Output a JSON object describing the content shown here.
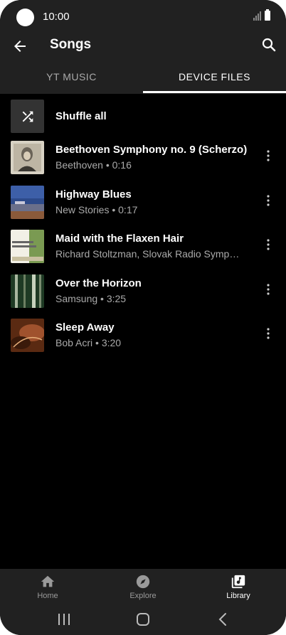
{
  "status_bar": {
    "time": "10:00"
  },
  "app_bar": {
    "title": "Songs"
  },
  "tabs": [
    {
      "label": "YT MUSIC",
      "selected": false
    },
    {
      "label": "DEVICE FILES",
      "selected": true
    }
  ],
  "shuffle": {
    "label": "Shuffle all",
    "icon": "shuffle-icon"
  },
  "songs": [
    {
      "title": "Beethoven Symphony no. 9 (Scherzo)",
      "subtitle": "Beethoven • 0:16"
    },
    {
      "title": "Highway Blues",
      "subtitle": "New Stories • 0:17"
    },
    {
      "title": "Maid with the Flaxen Hair",
      "subtitle": "Richard Stoltzman, Slovak Radio Symp…"
    },
    {
      "title": "Over the Horizon",
      "subtitle": "Samsung • 3:25"
    },
    {
      "title": "Sleep Away",
      "subtitle": "Bob Acri • 3:20"
    }
  ],
  "bottom_nav": [
    {
      "label": "Home",
      "icon": "home-icon",
      "active": false
    },
    {
      "label": "Explore",
      "icon": "compass-icon",
      "active": false
    },
    {
      "label": "Library",
      "icon": "library-music-icon",
      "active": true
    }
  ],
  "colors": {
    "background": "#000000",
    "surface": "#212121",
    "text": "#ffffff",
    "secondary_text": "#aaaaaa"
  }
}
